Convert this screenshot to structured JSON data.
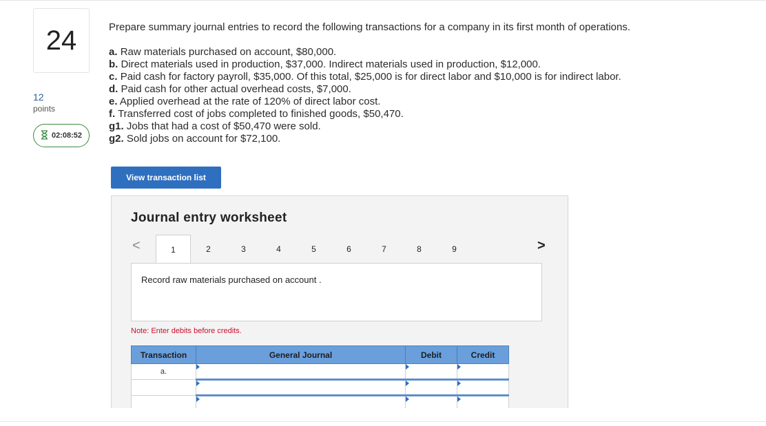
{
  "question": {
    "number": "24",
    "points_value": "12",
    "points_label": "points",
    "timer": "02:08:52"
  },
  "problem": {
    "prompt": "Prepare summary journal entries to record the following transactions for a company in its first month of operations.",
    "transactions": [
      {
        "letter": "a.",
        "text": "Raw materials purchased on account, $80,000."
      },
      {
        "letter": "b.",
        "text": "Direct materials used in production, $37,000. Indirect materials used in production, $12,000."
      },
      {
        "letter": "c.",
        "text": "Paid cash for factory payroll, $35,000. Of this total, $25,000 is for direct labor and $10,000 is for indirect labor."
      },
      {
        "letter": "d.",
        "text": "Paid cash for other actual overhead costs, $7,000."
      },
      {
        "letter": "e.",
        "text": "Applied overhead at the rate of 120% of direct labor cost."
      },
      {
        "letter": "f.",
        "text": "Transferred cost of jobs completed to finished goods, $50,470."
      },
      {
        "letter": "g1.",
        "text": "Jobs that had a cost of $50,470 were sold."
      },
      {
        "letter": "g2.",
        "text": "Sold jobs on account for $72,100."
      }
    ]
  },
  "view_button_label": "View transaction list",
  "worksheet": {
    "title": "Journal entry worksheet",
    "prev_arrow": "<",
    "next_arrow": ">",
    "tabs": [
      "1",
      "2",
      "3",
      "4",
      "5",
      "6",
      "7",
      "8",
      "9"
    ],
    "active_tab": "1",
    "description": "Record raw materials purchased on account .",
    "note": "Note: Enter debits before credits.",
    "columns": {
      "transaction": "Transaction",
      "general_journal": "General Journal",
      "debit": "Debit",
      "credit": "Credit"
    },
    "rows": [
      {
        "transaction": "a."
      },
      {
        "transaction": ""
      },
      {
        "transaction": ""
      }
    ]
  }
}
